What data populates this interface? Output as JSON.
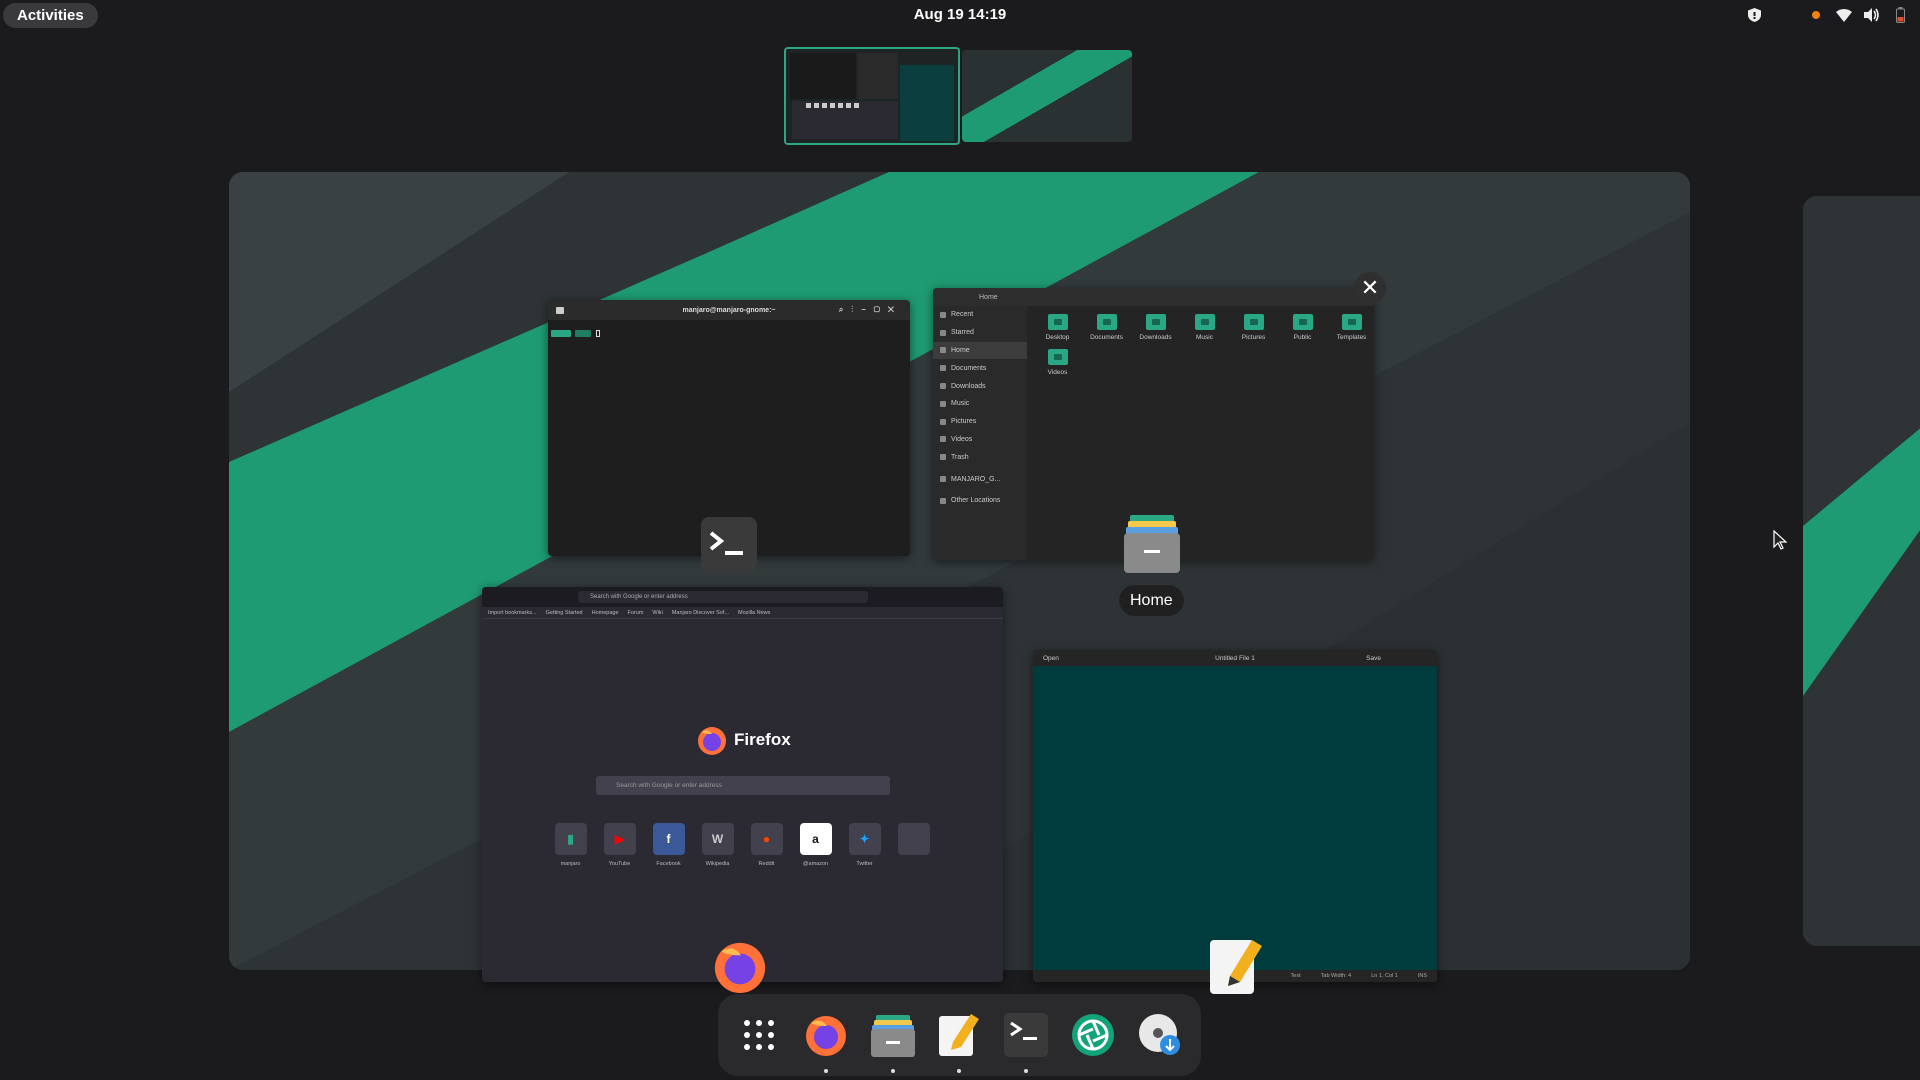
{
  "topbar": {
    "activities_label": "Activities",
    "clock": "Aug 19  14:19",
    "tray_icons": [
      "shield-icon",
      "notification-dot-icon",
      "wifi-icon",
      "volume-icon",
      "battery-icon"
    ]
  },
  "colors": {
    "accent": "#2aa784",
    "panel": "#1b1b1d",
    "editor_bg": "#003c3e"
  },
  "terminal": {
    "title": "manjaro@manjaro-gnome:~",
    "icon": "terminal-icon"
  },
  "files": {
    "path": "Home",
    "sidebar": [
      "Recent",
      "Starred",
      "Home",
      "Documents",
      "Downloads",
      "Music",
      "Pictures",
      "Videos",
      "Trash",
      "MANJARO_G...",
      "Other Locations"
    ],
    "folders": [
      "Desktop",
      "Documents",
      "Downloads",
      "Music",
      "Pictures",
      "Public",
      "Templates",
      "Videos"
    ],
    "window_label": "Home"
  },
  "firefox": {
    "url_placeholder": "Search with Google or enter address",
    "bookmarks": [
      "Import bookmarks...",
      "Getting Started",
      "Homepage",
      "Forum",
      "Wiki",
      "Manjaro Discover Sof...",
      "Mozilla News"
    ],
    "brand": "Firefox",
    "search_placeholder": "Search with Google or enter address",
    "tiles": [
      {
        "label": "manjaro",
        "color": "#2aa784",
        "glyph": "▮"
      },
      {
        "label": "YouTube",
        "color": "#ff0000",
        "glyph": "▶"
      },
      {
        "label": "Facebook",
        "color": "#3b5998",
        "glyph": "f"
      },
      {
        "label": "Wikipedia",
        "color": "#cccccc",
        "glyph": "W"
      },
      {
        "label": "Reddit",
        "color": "#ff4500",
        "glyph": "●"
      },
      {
        "label": "@amazon",
        "color": "#ffffff",
        "glyph": "a"
      },
      {
        "label": "Twitter",
        "color": "#1da1f2",
        "glyph": "✦"
      },
      {
        "label": "",
        "color": "#42414d",
        "glyph": ""
      }
    ]
  },
  "editor": {
    "title": "Untitled File 1",
    "open_label": "Open",
    "save_label": "Save",
    "status": [
      "Text",
      "Tab Width: 4",
      "Ln 1, Col 1",
      "INS"
    ]
  },
  "dash": {
    "items": [
      {
        "name": "show-apps-icon",
        "running": false
      },
      {
        "name": "firefox-icon",
        "running": true
      },
      {
        "name": "files-icon",
        "running": true
      },
      {
        "name": "text-editor-icon",
        "running": true
      },
      {
        "name": "terminal-icon",
        "running": true
      },
      {
        "name": "shutter-icon",
        "running": false
      },
      {
        "name": "disk-installer-icon",
        "running": false
      }
    ]
  }
}
